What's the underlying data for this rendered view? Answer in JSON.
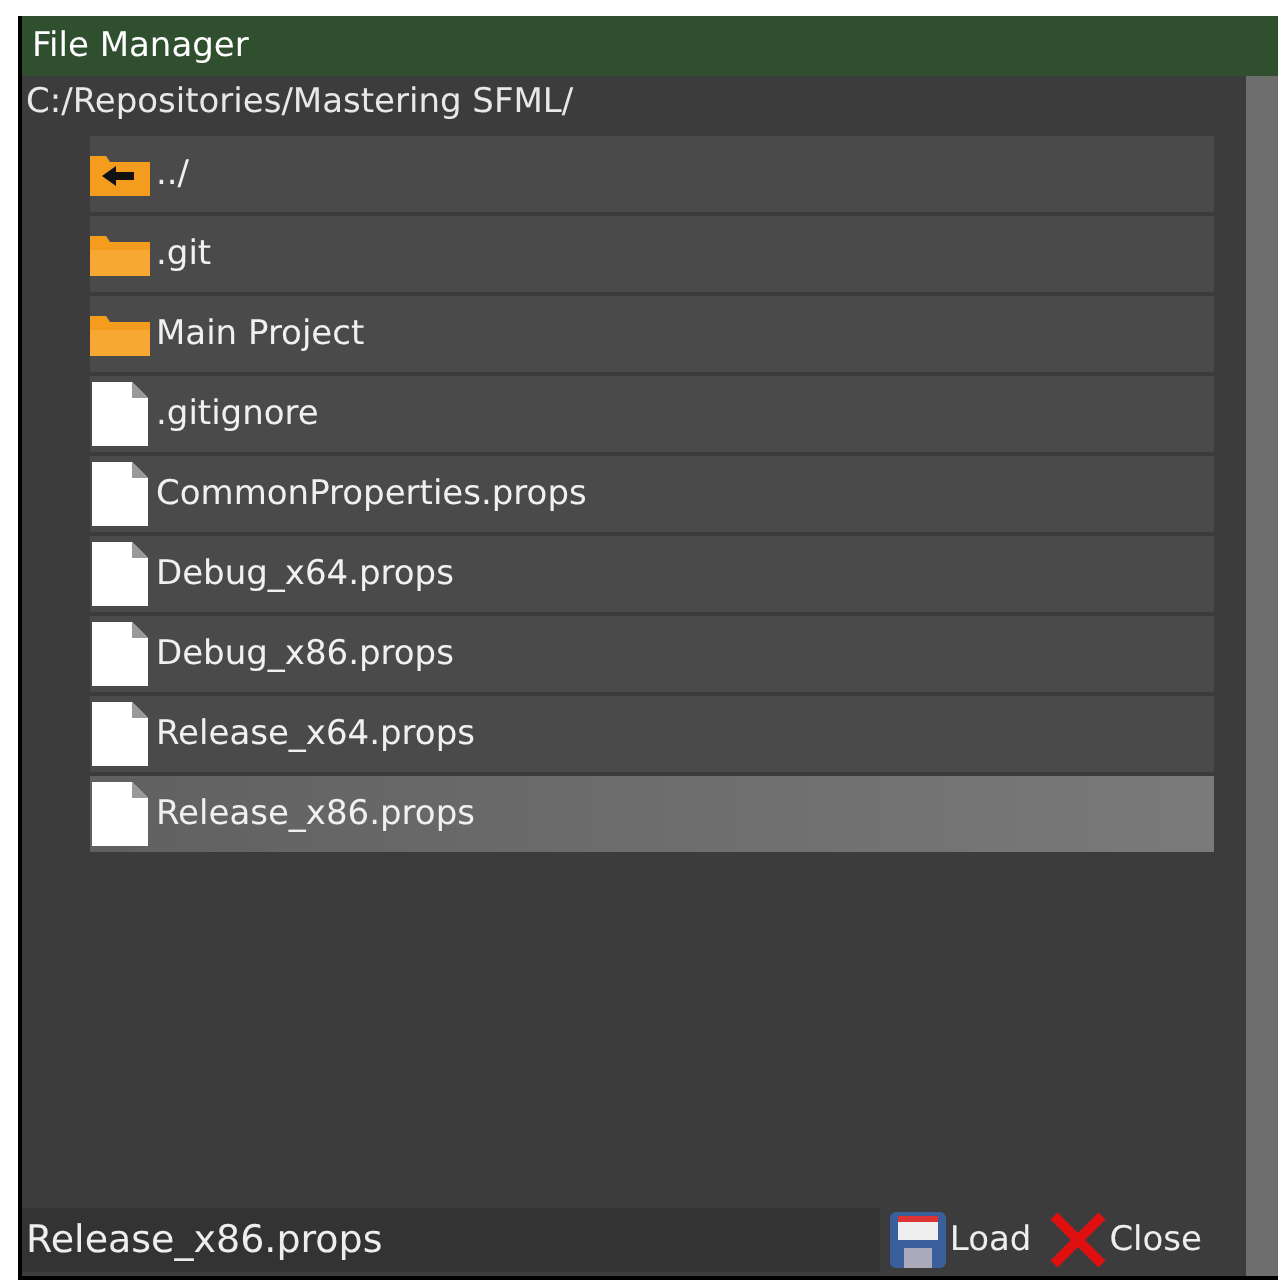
{
  "window": {
    "title": "File Manager"
  },
  "path": "C:/Repositories/Mastering SFML/",
  "items": [
    {
      "kind": "up",
      "name": "../",
      "selected": false
    },
    {
      "kind": "folder",
      "name": ".git",
      "selected": false
    },
    {
      "kind": "folder",
      "name": "Main Project",
      "selected": false
    },
    {
      "kind": "file",
      "name": ".gitignore",
      "selected": false
    },
    {
      "kind": "file",
      "name": "CommonProperties.props",
      "selected": false
    },
    {
      "kind": "file",
      "name": "Debug_x64.props",
      "selected": false
    },
    {
      "kind": "file",
      "name": "Debug_x86.props",
      "selected": false
    },
    {
      "kind": "file",
      "name": "Release_x64.props",
      "selected": false
    },
    {
      "kind": "file",
      "name": "Release_x86.props",
      "selected": true
    }
  ],
  "footer": {
    "filename": "Release_x86.props",
    "buttons": [
      {
        "kind": "load",
        "label": "Load"
      },
      {
        "kind": "close",
        "label": "Close"
      }
    ]
  }
}
